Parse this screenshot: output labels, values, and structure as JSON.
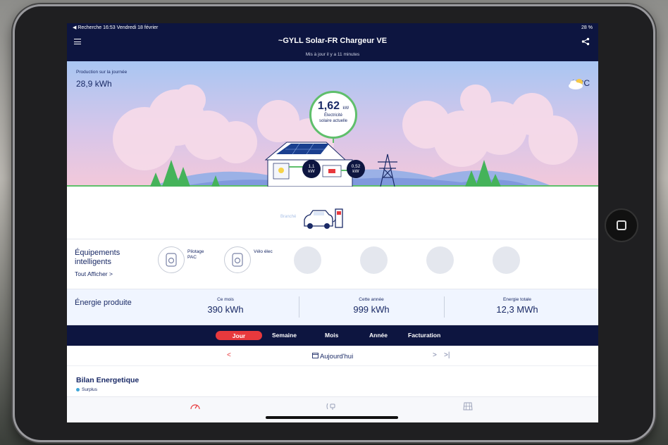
{
  "status_bar": {
    "left": "◀ Recherche  16:53  Vendredi 18 février",
    "right": "28 %"
  },
  "header": {
    "title": "~GYLL Solar-FR Chargeur VE",
    "subtitle": "Mis à jour il y a 11 minutes"
  },
  "hero": {
    "production_label": "Production sur la journée",
    "production_value": "28,9 kWh",
    "temperature": "15°C",
    "current_value": "1,62",
    "current_unit": "kW",
    "current_label_1": "Électricité",
    "current_label_2": "solaire actuelle",
    "home_flow_value": "1,1",
    "home_flow_unit": "kW",
    "grid_flow_value": "0,52",
    "grid_flow_unit": "kW"
  },
  "car": {
    "label": "Branché"
  },
  "equipment": {
    "title_line1": "Équipements",
    "title_line2": "intelligents",
    "show_all": "Tout Afficher >",
    "devices": [
      {
        "label_line1": "Pilotage",
        "label_line2": "PAC"
      },
      {
        "label_line1": "Vélo élec",
        "label_line2": ""
      }
    ]
  },
  "energy": {
    "title": "Énergie produite",
    "columns": [
      {
        "label": "Ce mois",
        "value": "390 kWh"
      },
      {
        "label": "Cette année",
        "value": "999 kWh"
      },
      {
        "label": "Energie totale",
        "value": "12,3 MWh"
      }
    ]
  },
  "tabs": [
    "Jour",
    "Semaine",
    "Mois",
    "Année",
    "Facturation"
  ],
  "date_nav": {
    "prev": "<",
    "date": "Aujourd'hui",
    "next": ">",
    "last": ">|"
  },
  "bilan": {
    "title": "Bilan Energetique",
    "legend": "Surplus"
  },
  "colors": {
    "navy": "#0d1540",
    "accent": "#e8393d",
    "green": "#5fbf6b"
  },
  "icons": [
    "menu-icon",
    "share-icon",
    "weather-icon",
    "plug-icon",
    "home-tab-icon",
    "chart-tab-icon",
    "grid-tab-icon",
    "calendar-icon"
  ]
}
